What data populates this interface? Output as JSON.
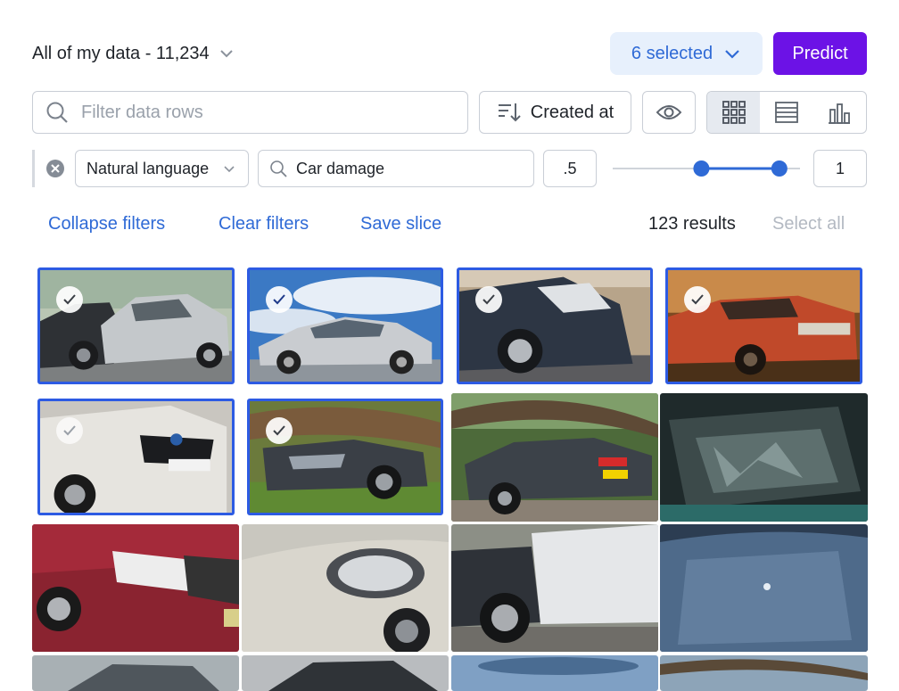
{
  "header": {
    "title": "All of my data - 11,234",
    "selected_label": "6 selected",
    "predict_label": "Predict"
  },
  "toolbar": {
    "search_placeholder": "Filter data rows",
    "sort_label": "Created at"
  },
  "filter": {
    "mode_label": "Natural language",
    "query": "Car damage",
    "threshold_min": ".5",
    "threshold_max": "1",
    "slider_min": 0.5,
    "slider_max": 1
  },
  "actions": {
    "collapse": "Collapse filters",
    "clear": "Clear filters",
    "save": "Save slice",
    "results": "123 results",
    "select_all": "Select all"
  },
  "colors": {
    "accent": "#2f6ad6",
    "primary": "#6c12e6",
    "selection_border": "#2d5be3"
  }
}
